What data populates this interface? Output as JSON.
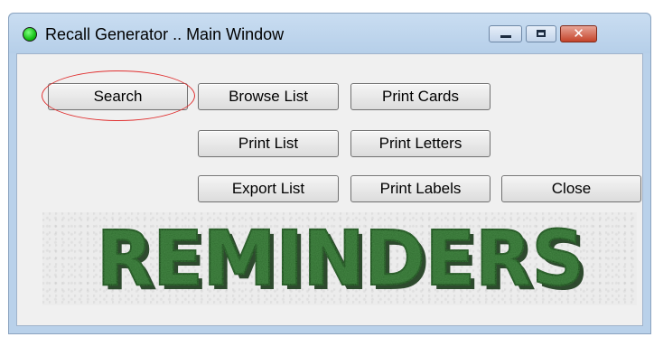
{
  "window": {
    "title": "Recall Generator .. Main Window",
    "status_color": "#16c016"
  },
  "title_controls": [
    "minimize-icon",
    "maximize-icon",
    "close-icon"
  ],
  "buttons": {
    "search": "Search",
    "browse_list": "Browse List",
    "print_cards": "Print Cards",
    "print_list": "Print List",
    "print_letters": "Print Letters",
    "export_list": "Export List",
    "print_labels": "Print Labels",
    "close": "Close"
  },
  "highlight_color": "#e03030",
  "banner": {
    "text": "REMINDERS",
    "text_color": "#2e6b2e"
  }
}
